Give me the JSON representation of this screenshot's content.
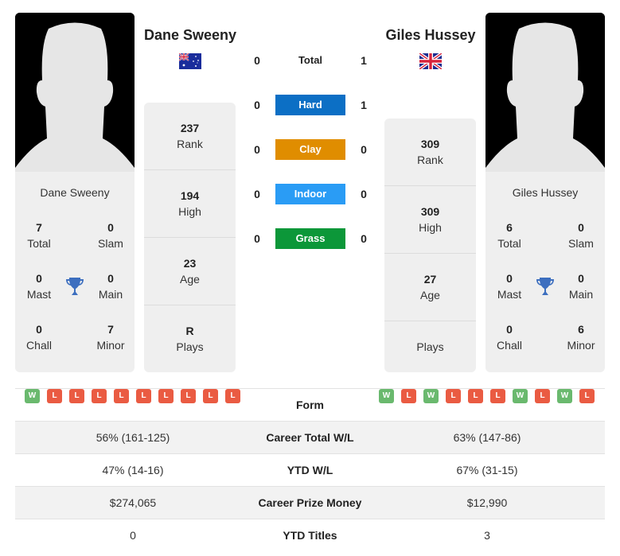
{
  "players": [
    {
      "name": "Dane Sweeny",
      "country": "Australia",
      "flag_icon": "australia-flag-icon",
      "titles": {
        "total": {
          "value": "7",
          "label": "Total"
        },
        "slam": {
          "value": "0",
          "label": "Slam"
        },
        "mast": {
          "value": "0",
          "label": "Mast"
        },
        "main": {
          "value": "0",
          "label": "Main"
        },
        "chall": {
          "value": "0",
          "label": "Chall"
        },
        "minor": {
          "value": "7",
          "label": "Minor"
        }
      },
      "stats": {
        "rank": {
          "value": "237",
          "label": "Rank"
        },
        "high": {
          "value": "194",
          "label": "High"
        },
        "age": {
          "value": "23",
          "label": "Age"
        },
        "plays": {
          "value": "R",
          "label": "Plays"
        }
      },
      "form": [
        "W",
        "L",
        "L",
        "L",
        "L",
        "L",
        "L",
        "L",
        "L",
        "L"
      ]
    },
    {
      "name": "Giles Hussey",
      "country": "United Kingdom",
      "flag_icon": "uk-flag-icon",
      "titles": {
        "total": {
          "value": "6",
          "label": "Total"
        },
        "slam": {
          "value": "0",
          "label": "Slam"
        },
        "mast": {
          "value": "0",
          "label": "Mast"
        },
        "main": {
          "value": "0",
          "label": "Main"
        },
        "chall": {
          "value": "0",
          "label": "Chall"
        },
        "minor": {
          "value": "6",
          "label": "Minor"
        }
      },
      "stats": {
        "rank": {
          "value": "309",
          "label": "Rank"
        },
        "high": {
          "value": "309",
          "label": "High"
        },
        "age": {
          "value": "27",
          "label": "Age"
        },
        "plays": {
          "value": "",
          "label": "Plays"
        }
      },
      "form": [
        "W",
        "L",
        "W",
        "L",
        "L",
        "L",
        "W",
        "L",
        "W",
        "L"
      ]
    }
  ],
  "h2h": [
    {
      "label": "Total",
      "left": "0",
      "right": "1",
      "color": null
    },
    {
      "label": "Hard",
      "left": "0",
      "right": "1",
      "color": "#0c6fc5"
    },
    {
      "label": "Clay",
      "left": "0",
      "right": "0",
      "color": "#e08d00"
    },
    {
      "label": "Indoor",
      "left": "0",
      "right": "0",
      "color": "#2a9cf5"
    },
    {
      "label": "Grass",
      "left": "0",
      "right": "0",
      "color": "#0c9739"
    }
  ],
  "comparison": {
    "form_label": "Form",
    "rows": [
      {
        "label": "Career Total W/L",
        "left": "56% (161-125)",
        "right": "63% (147-86)"
      },
      {
        "label": "YTD W/L",
        "left": "47% (14-16)",
        "right": "67% (31-15)"
      },
      {
        "label": "Career Prize Money",
        "left": "$274,065",
        "right": "$12,990"
      },
      {
        "label": "YTD Titles",
        "left": "0",
        "right": "3"
      }
    ]
  },
  "colors": {
    "win": "#6ab96e",
    "loss": "#ea5b42",
    "card_bg": "#efefef",
    "trophy": "#3d6fbf"
  }
}
